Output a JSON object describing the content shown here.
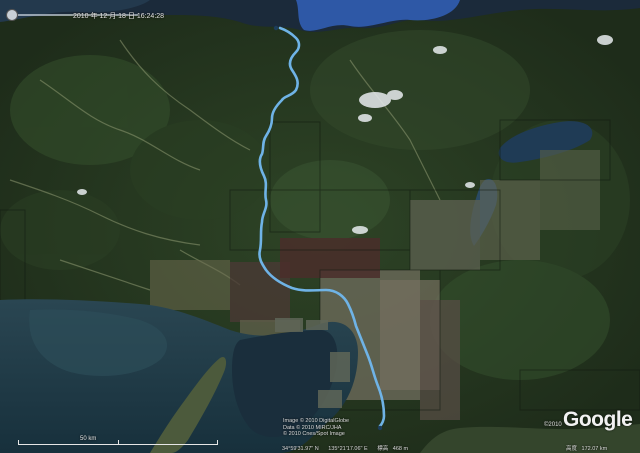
{
  "map": {
    "type": "satellite",
    "route_color": "#6fb3e6",
    "sea_color": "#1f3a48",
    "bay_color": "#2d5aa8",
    "forest_color": "#26381f",
    "urban_color": "#6f6c58"
  },
  "timeslider": {
    "date": "2010 年 12 月 18 日 16:24:28"
  },
  "scale": {
    "label": "50 km"
  },
  "credits": {
    "line1": "Image © 2010 DigitalGlobe",
    "line2": "Data © 2010 MIRC/JHA",
    "line3": "© 2010 Cnes/Spot Image"
  },
  "status": {
    "lat": "34°59'31.97\" N",
    "lon": "135°21'17.06\" E",
    "elev_label": "標高",
    "elev": "468 m",
    "eye_label": "高度",
    "eye": "172.07 km"
  },
  "copyright": "©2010",
  "logo": "Google"
}
